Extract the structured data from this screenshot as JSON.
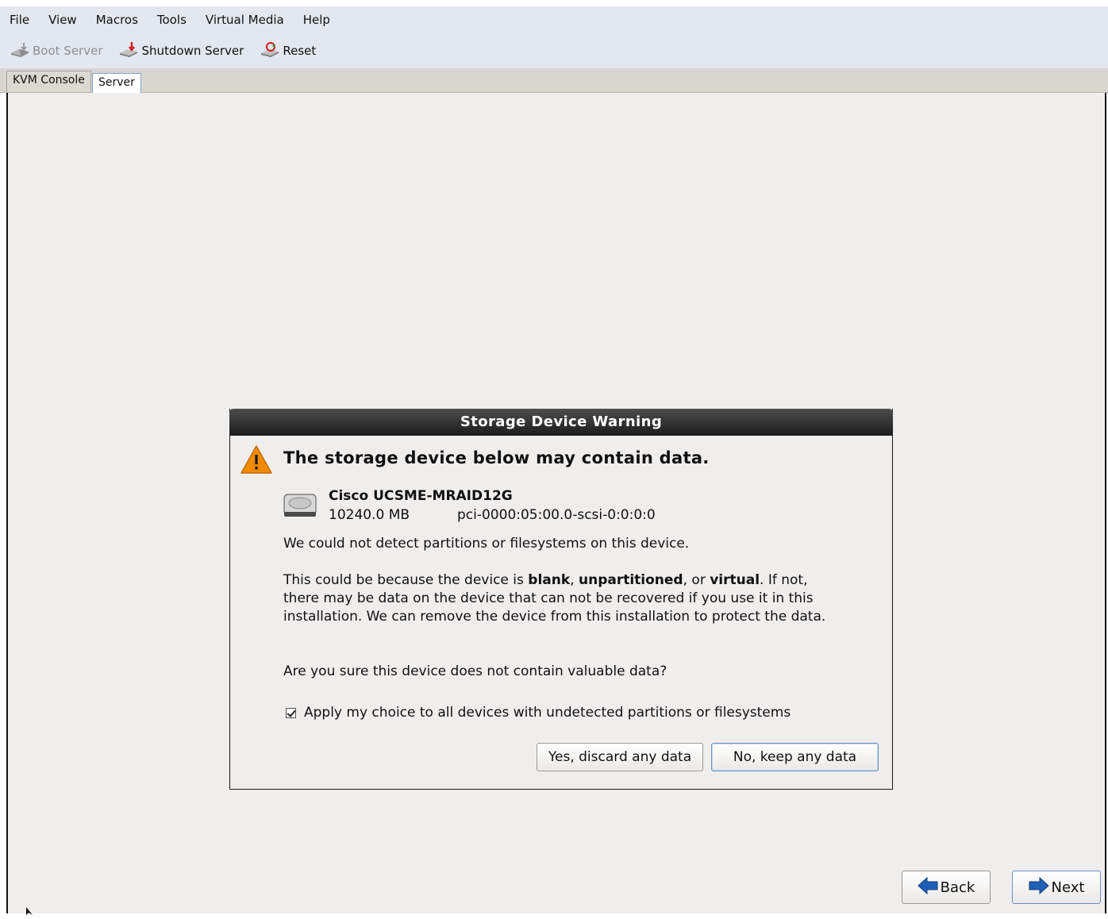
{
  "menubar": {
    "items": [
      "File",
      "View",
      "Macros",
      "Tools",
      "Virtual Media",
      "Help"
    ]
  },
  "toolbar": {
    "boot_label": "Boot Server",
    "shutdown_label": "Shutdown Server",
    "reset_label": "Reset"
  },
  "tabs": [
    {
      "label": "KVM Console"
    },
    {
      "label": "Server"
    }
  ],
  "dialog": {
    "title": "Storage Device Warning",
    "headline": "The storage device below may contain data.",
    "device_name": "Cisco UCSME-MRAID12G",
    "device_size": "10240.0 MB",
    "device_path": "pci-0000:05:00.0-scsi-0:0:0:0",
    "message1": "We could not detect partitions or filesystems on this device.",
    "message2_pre": "This could be because the device is ",
    "message2_b1": "blank",
    "message2_sep1": ", ",
    "message2_b2": "unpartitioned",
    "message2_sep2": ", or ",
    "message2_b3": "virtual",
    "message2_post": ". If not, there may be data on the device that can not be recovered if you use it in this installation. We can remove the device from this installation to protect the data.",
    "message3": "Are you sure this device does not contain valuable data?",
    "checkbox_label": "Apply my choice to all devices with undetected partitions or filesystems",
    "checkbox_checked": true,
    "yes_button": "Yes, discard any data",
    "no_button": "No, keep any data"
  },
  "nav": {
    "back_label": "Back",
    "next_label": "Next"
  },
  "colors": {
    "warning": "#f08a00",
    "arrow_blue": "#1f5fb5",
    "toolbar_bg": "#e3e7ef"
  }
}
